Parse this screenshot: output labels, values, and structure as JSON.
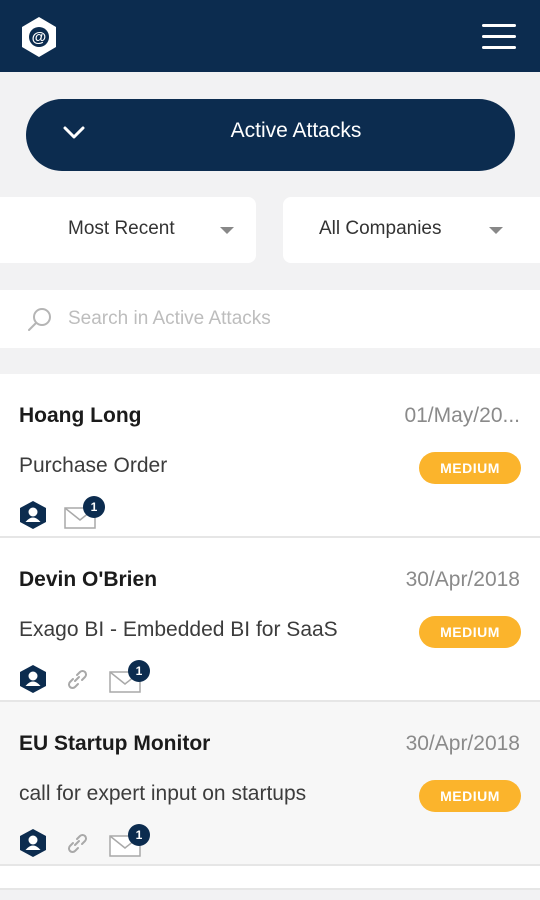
{
  "header": {
    "logo_icon": "at-sign-hexagon-icon",
    "menu_icon": "hamburger-menu-icon"
  },
  "section": {
    "title": "Active Attacks",
    "toggle_icon": "chevron-down-icon"
  },
  "filters": {
    "sort": "Most Recent",
    "company": "All Companies"
  },
  "search": {
    "placeholder": "Search in Active Attacks",
    "value": ""
  },
  "colors": {
    "navy": "#0c2c4f",
    "medium": "#fbb42c",
    "background": "#f2f2f3"
  },
  "attacks": [
    {
      "sender": "Hoang Long",
      "date": "01/May/20...",
      "subject": "Purchase Order",
      "severity": "MEDIUM",
      "has_link": false,
      "mail_count": "1"
    },
    {
      "sender": "Devin O'Brien",
      "date": "30/Apr/2018",
      "subject": "Exago BI - Embedded BI for SaaS",
      "severity": "MEDIUM",
      "has_link": true,
      "mail_count": "1"
    },
    {
      "sender": "EU Startup Monitor",
      "date": "30/Apr/2018",
      "subject": "call for expert input on startups",
      "severity": "MEDIUM",
      "has_link": true,
      "mail_count": "1"
    }
  ]
}
